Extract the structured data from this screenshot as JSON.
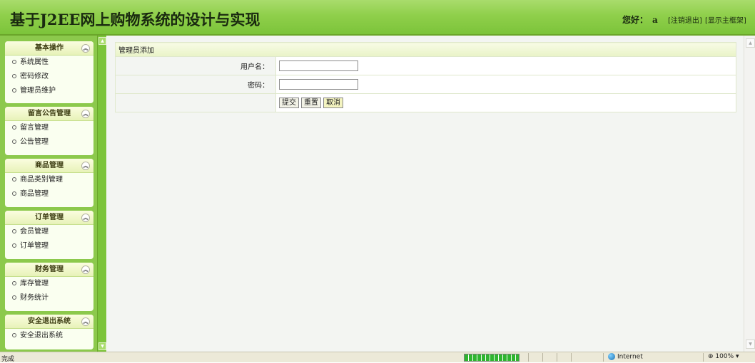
{
  "header": {
    "title": "基于J2EE网上购物系统的设计与实现",
    "greeting_label": "您好：",
    "username": "a",
    "logout_link": "[注销退出]",
    "show_main_link": "[显示主框架]"
  },
  "sidebar": {
    "panels": [
      {
        "title": "基本操作",
        "items": [
          "系统属性",
          "密码修改",
          "管理员维护"
        ]
      },
      {
        "title": "留言公告管理",
        "items": [
          "留言管理",
          "公告管理"
        ]
      },
      {
        "title": "商品管理",
        "items": [
          "商品类别管理",
          "商品管理"
        ]
      },
      {
        "title": "订单管理",
        "items": [
          "会员管理",
          "订单管理"
        ]
      },
      {
        "title": "财务管理",
        "items": [
          "库存管理",
          "财务统计"
        ]
      },
      {
        "title": "安全退出系统",
        "items": [
          "安全退出系统"
        ]
      }
    ],
    "collapse_icon": "chevron-double-up-icon"
  },
  "form": {
    "caption": "管理员添加",
    "username_label": "用户名：",
    "username_value": "",
    "password_label": "密码：",
    "password_value": "",
    "buttons": {
      "submit": "提交",
      "reset": "重置",
      "cancel": "取消"
    }
  },
  "statusbar": {
    "status_text": "完成",
    "zone_text": "Internet",
    "zoom_text": "100%"
  },
  "colors": {
    "header_green": "#8fcf4b",
    "sidebar_green": "#8cc94c",
    "panel_bg": "#fafff0",
    "main_bg": "#f3f5f2"
  }
}
